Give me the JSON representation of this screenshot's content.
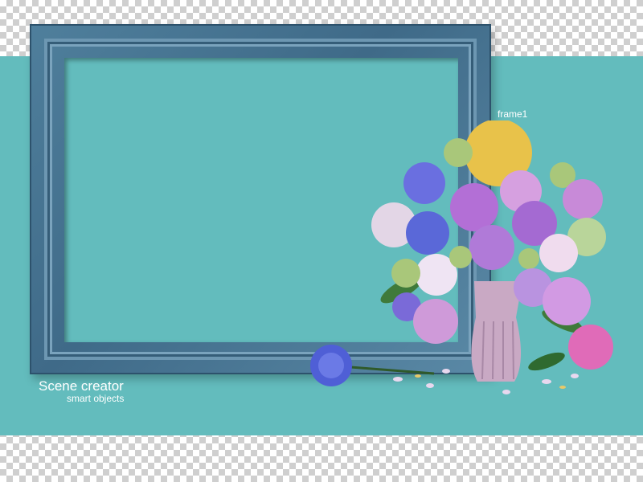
{
  "scene": {
    "frame_label": "frame1",
    "brand_title": "Scene creator",
    "brand_subtitle": "smart objects"
  },
  "colors": {
    "backdrop": "#63bcbd",
    "frame": "#4a7896",
    "checker": "#cfcfcf"
  },
  "illustration": {
    "subject": "flower-bouquet-in-vase-icon",
    "vase_color": "#c9a9c4",
    "flower_colors": [
      "#b36fd6",
      "#6a6fe0",
      "#d6a0e0",
      "#e8c24a",
      "#a9c77a",
      "#e06bb8",
      "#ffffff"
    ]
  }
}
